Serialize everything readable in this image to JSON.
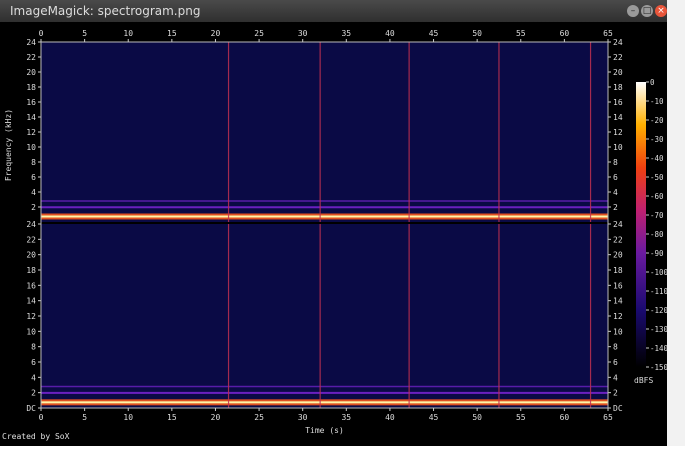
{
  "window": {
    "title": "ImageMagick: spectrogram.png",
    "buttons": {
      "minimize": "–",
      "maximize": "□",
      "close": "×"
    }
  },
  "credit": "Created by SoX",
  "chart_data": {
    "type": "heatmap",
    "title": "",
    "xlabel": "Time (s)",
    "ylabel": "Frequency (kHz)",
    "xlim": [
      0,
      65
    ],
    "x_ticks": [
      "0",
      "5",
      "10",
      "15",
      "20",
      "25",
      "30",
      "35",
      "40",
      "45",
      "50",
      "55",
      "60",
      "65"
    ],
    "channels": [
      {
        "name": "upper",
        "y_ticks": [
          "2",
          "4",
          "6",
          "8",
          "10",
          "12",
          "14",
          "16",
          "18",
          "20",
          "22",
          "24"
        ],
        "bands_khz": [
          0.5,
          1.0,
          2.1,
          2.9
        ],
        "bottom_label": "24"
      },
      {
        "name": "lower",
        "y_ticks": [
          "DC",
          "2",
          "4",
          "6",
          "8",
          "10",
          "12",
          "14",
          "16",
          "18",
          "20",
          "22",
          "24"
        ],
        "bands_khz": [
          0.5,
          1.0,
          2.1,
          2.9
        ],
        "bottom_label": "DC"
      }
    ],
    "ylim_khz": [
      0,
      24
    ],
    "vertical_lines_s": [
      21.5,
      32,
      42.2,
      52.5,
      63
    ],
    "colorbar": {
      "unit": "dBFS",
      "ticks": [
        "0",
        "-10",
        "-20",
        "-30",
        "-40",
        "-50",
        "-60",
        "-70",
        "-80",
        "-90",
        "-100",
        "-110",
        "-120",
        "-130",
        "-140",
        "-150"
      ],
      "range": [
        -150,
        0
      ]
    },
    "colors": {
      "background": "#0a0a45",
      "band_hot": "#fff6a8",
      "band_warm": "#e05020",
      "band_cool": "#6a20c0",
      "vline": "#c03050"
    }
  }
}
